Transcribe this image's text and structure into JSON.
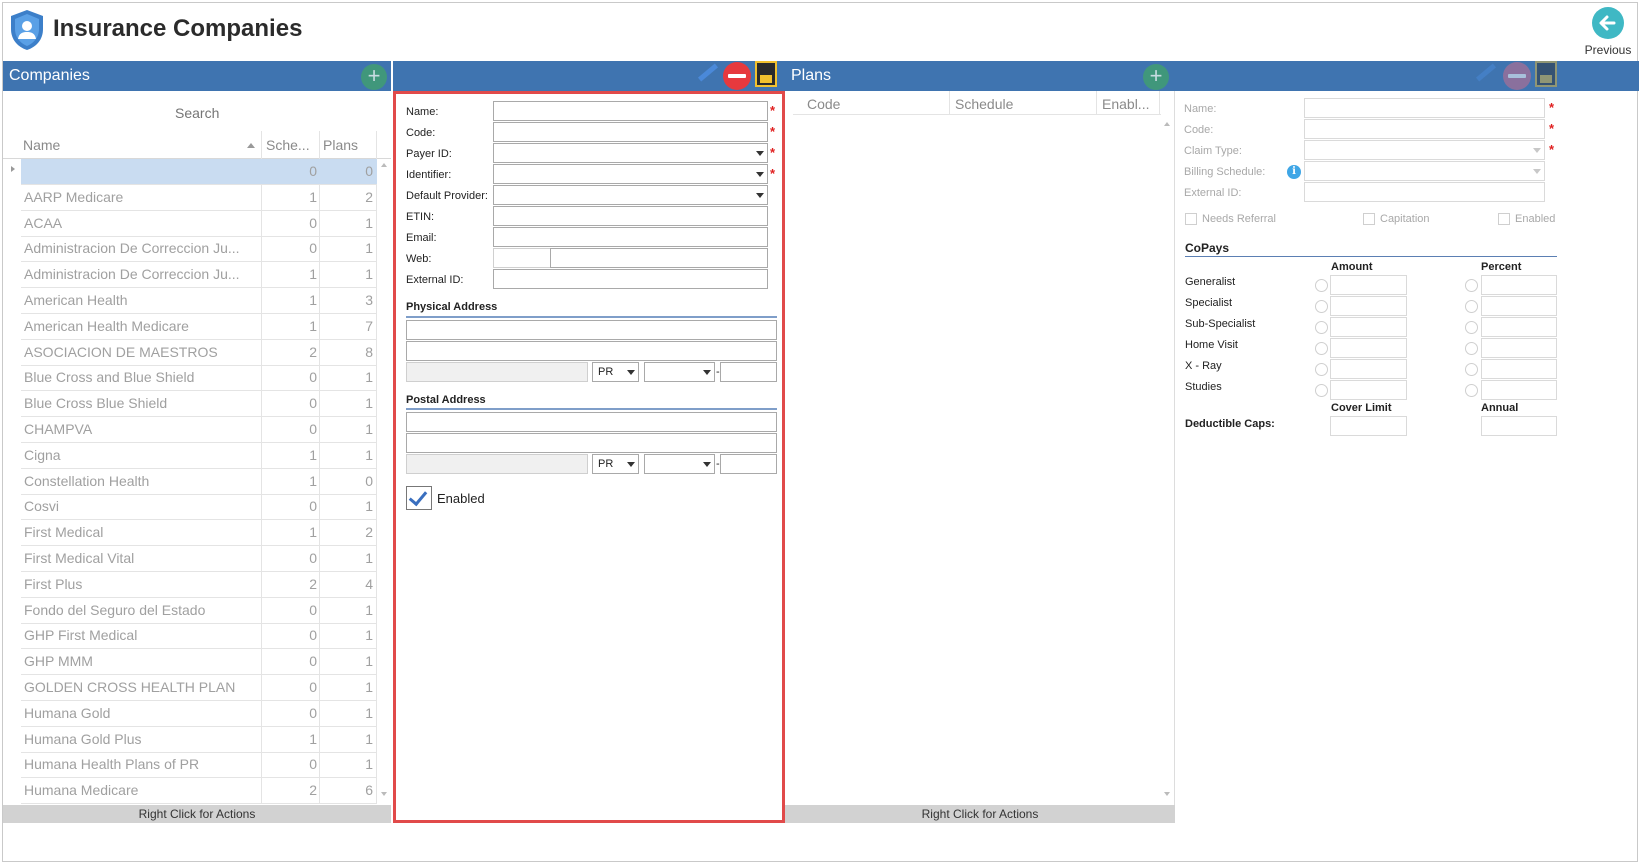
{
  "app": {
    "title": "Insurance Companies",
    "previous_label": "Previous"
  },
  "companies": {
    "title": "Companies",
    "search_placeholder": "Search",
    "columns": [
      "Name",
      "Sche...",
      "Plans"
    ],
    "rows": [
      {
        "name": "",
        "schedules": "0",
        "plans": "0"
      },
      {
        "name": "AARP Medicare",
        "schedules": "1",
        "plans": "2"
      },
      {
        "name": "ACAA",
        "schedules": "0",
        "plans": "1"
      },
      {
        "name": "Administracion De Correccion Ju...",
        "schedules": "0",
        "plans": "1"
      },
      {
        "name": "Administracion De Correccion Ju...",
        "schedules": "1",
        "plans": "1"
      },
      {
        "name": "American Health",
        "schedules": "1",
        "plans": "3"
      },
      {
        "name": "American Health Medicare",
        "schedules": "1",
        "plans": "7"
      },
      {
        "name": "ASOCIACION DE MAESTROS",
        "schedules": "2",
        "plans": "8"
      },
      {
        "name": "Blue Cross and Blue Shield",
        "schedules": "0",
        "plans": "1"
      },
      {
        "name": "Blue Cross Blue Shield",
        "schedules": "0",
        "plans": "1"
      },
      {
        "name": "CHAMPVA",
        "schedules": "0",
        "plans": "1"
      },
      {
        "name": "Cigna",
        "schedules": "1",
        "plans": "1"
      },
      {
        "name": "Constellation Health",
        "schedules": "1",
        "plans": "0"
      },
      {
        "name": "Cosvi",
        "schedules": "0",
        "plans": "1"
      },
      {
        "name": "First Medical",
        "schedules": "1",
        "plans": "2"
      },
      {
        "name": "First Medical Vital",
        "schedules": "0",
        "plans": "1"
      },
      {
        "name": "First Plus",
        "schedules": "2",
        "plans": "4"
      },
      {
        "name": "Fondo del Seguro del Estado",
        "schedules": "0",
        "plans": "1"
      },
      {
        "name": "GHP First Medical",
        "schedules": "0",
        "plans": "1"
      },
      {
        "name": "GHP MMM",
        "schedules": "0",
        "plans": "1"
      },
      {
        "name": "GOLDEN CROSS HEALTH PLAN",
        "schedules": "0",
        "plans": "1"
      },
      {
        "name": "Humana Gold",
        "schedules": "0",
        "plans": "1"
      },
      {
        "name": "Humana Gold Plus",
        "schedules": "1",
        "plans": "1"
      },
      {
        "name": "Humana Health Plans of PR",
        "schedules": "0",
        "plans": "1"
      },
      {
        "name": "Humana Medicare",
        "schedules": "2",
        "plans": "6"
      }
    ],
    "footer": "Right Click for Actions"
  },
  "company_form": {
    "labels": {
      "name": "Name:",
      "code": "Code:",
      "payer_id": "Payer ID:",
      "identifier": "Identifier:",
      "default_provider": "Default Provider:",
      "etin": "ETIN:",
      "email": "Email:",
      "web": "Web:",
      "external_id": "External ID:"
    },
    "required_mark": "*",
    "physical_address": {
      "title": "Physical Address",
      "state": "PR",
      "zip_sep": "-"
    },
    "postal_address": {
      "title": "Postal Address",
      "state": "PR",
      "zip_sep": "-"
    },
    "enabled_label": "Enabled",
    "enabled": true
  },
  "plans": {
    "title": "Plans",
    "columns": [
      "Code",
      "Schedule",
      "Enabl..."
    ],
    "footer": "Right Click for Actions"
  },
  "plan_form": {
    "labels": {
      "name": "Name:",
      "code": "Code:",
      "claim_type": "Claim Type:",
      "billing_schedule": "Billing Schedule:",
      "external_id": "External ID:"
    },
    "info_glyph": "i",
    "checks": {
      "needs_referral": "Needs Referral",
      "capitation": "Capitation",
      "enabled": "Enabled"
    },
    "copays": {
      "title": "CoPays",
      "amount_header": "Amount",
      "percent_header": "Percent",
      "rows": [
        "Generalist",
        "Specialist",
        "Sub-Specialist",
        "Home Visit",
        "X - Ray",
        "Studies"
      ],
      "cover_limit_header": "Cover Limit",
      "annual_header": "Annual",
      "deductible_label": "Deductible Caps:"
    }
  },
  "colors": {
    "header_bar": "#3f74b0",
    "form_highlight": "#e14a4a",
    "selected_row": "#c9dcf1"
  }
}
